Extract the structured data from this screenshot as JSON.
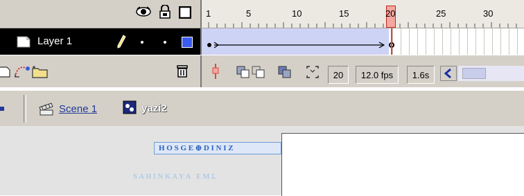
{
  "timeline": {
    "header_icons": [
      "eye-icon",
      "lock-icon",
      "outline-square-icon"
    ],
    "ruler_labels": [
      "1",
      "5",
      "10",
      "15",
      "20",
      "25",
      "30"
    ],
    "playhead_frame": "20",
    "layer": {
      "name": "Layer 1",
      "icons": [
        "layer-page-icon",
        "pencil-icon",
        "visible-dot",
        "lock-dot",
        "outline-swatch"
      ],
      "outline_color": "#3a5bf0"
    },
    "tools_icons": [
      "insert-layer-icon",
      "add-motion-guide-icon",
      "insert-folder-icon",
      "trash-icon"
    ],
    "status": {
      "current_frame": "20",
      "frame_rate": "12.0 fps",
      "elapsed_time": "1.6s"
    },
    "status_icons": [
      "center-frame-icon",
      "onion-skin-icon",
      "onion-skin-outlines-icon",
      "edit-multiple-frames-icon",
      "modify-onion-markers-icon"
    ]
  },
  "breadcrumb": {
    "scene_label": "Scene 1",
    "symbol_label": "yazi2"
  },
  "stage": {
    "text_line_1": "H O S G E ⊕ D I N I Z",
    "text_line_2": "S A H I N K A Y A   E M L"
  },
  "colors": {
    "panel_gray": "#d4d0c8",
    "selected_layer": "#000000",
    "playhead": "#e0463a",
    "text_blue": "#6f9bd6"
  }
}
